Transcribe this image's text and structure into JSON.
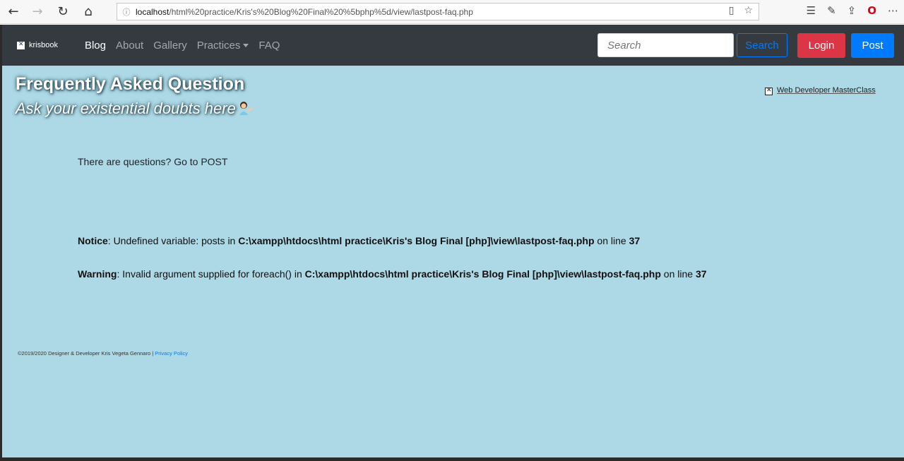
{
  "browser": {
    "url_host": "localhost",
    "url_path": "/html%20practice/Kris's%20Blog%20Final%20%5bphp%5d/view/lastpost-faq.php"
  },
  "navbar": {
    "brand": "krisbook",
    "links": [
      "Blog",
      "About",
      "Gallery",
      "Practices",
      "FAQ"
    ],
    "search_placeholder": "Search",
    "search_button": "Search",
    "login_button": "Login",
    "post_button": "Post",
    "colors": {
      "navbar_bg": "#343a40",
      "login": "#dc3545",
      "post": "#007bff"
    }
  },
  "hero": {
    "title": "Frequently Asked Question",
    "subtitle": "Ask your existential doubts here"
  },
  "ad": {
    "text": "Web Developer MasterClass"
  },
  "main": {
    "question_text": "There are questions? Go to POST",
    "notice": {
      "label": "Notice",
      "message": ": Undefined variable: posts in ",
      "file": "C:\\xampp\\htdocs\\html practice\\Kris's Blog Final [php]\\view\\lastpost-faq.php",
      "on_line": " on line ",
      "line": "37"
    },
    "warning": {
      "label": "Warning",
      "message": ": Invalid argument supplied for foreach() in ",
      "file": "C:\\xampp\\htdocs\\html practice\\Kris's Blog Final [php]\\view\\lastpost-faq.php",
      "on_line": " on line ",
      "line": "37"
    },
    "background": "#add8e6"
  },
  "footer": {
    "text": "©2019/2020 Designer & Developer Kris Vegeta Gennaro | ",
    "link": "Privacy Policy"
  }
}
